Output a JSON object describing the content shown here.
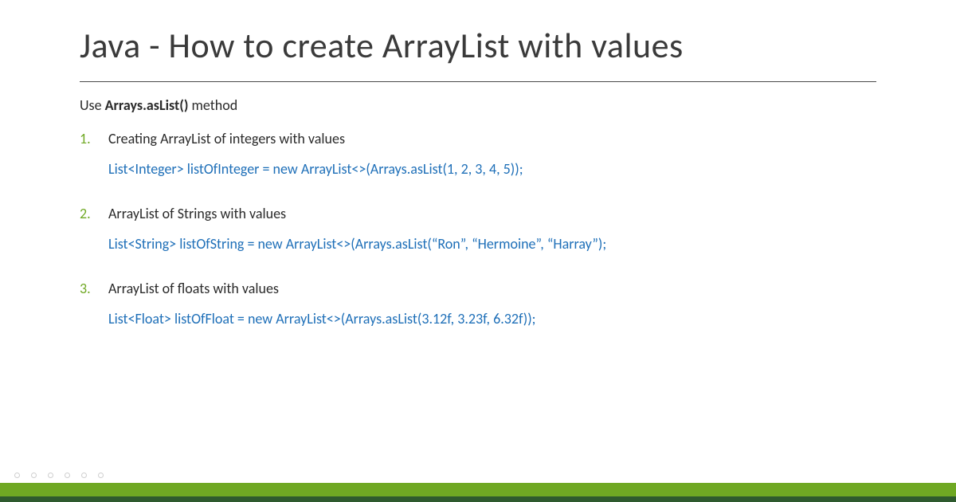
{
  "title": "Java - How to create ArrayList with values",
  "intro_prefix": "Use ",
  "intro_bold": "Arrays.asList()",
  "intro_suffix": " method",
  "items": [
    {
      "text": "Creating ArrayList of integers with values",
      "code": "List<Integer> listOfInteger = new ArrayList<>(Arrays.asList(1, 2, 3, 4, 5));"
    },
    {
      "text": "ArrayList of Strings with values",
      "code": "List<String> listOfString = new ArrayList<>(Arrays.asList(“Ron”, “Hermoine”, “Harray”);"
    },
    {
      "text": "ArrayList of floats with values",
      "code": "List<Float> listOfFloat = new ArrayList<>(Arrays.asList(3.12f, 3.23f, 6.32f));"
    }
  ]
}
